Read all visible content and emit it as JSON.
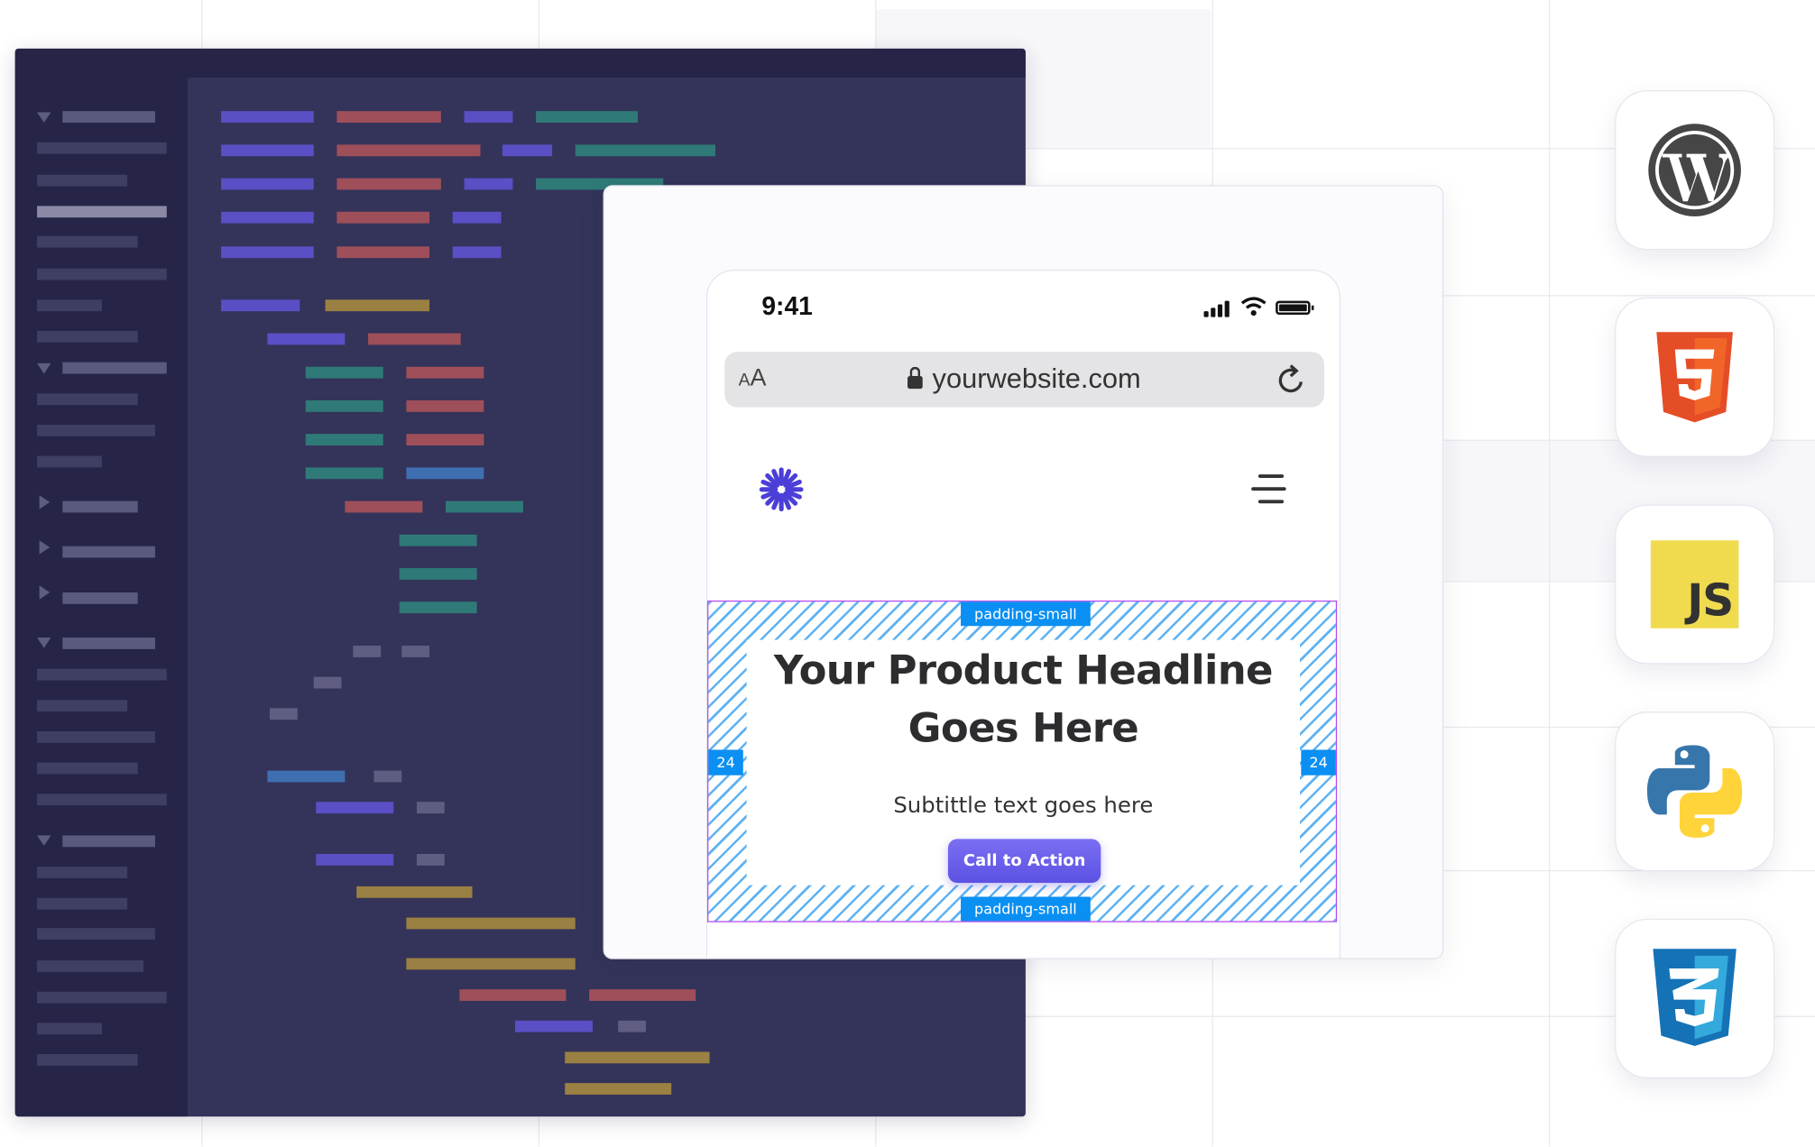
{
  "phone": {
    "status_time": "9:41",
    "url": "yourwebsite.com",
    "aa_label_small": "A",
    "aa_label_large": "A"
  },
  "hero": {
    "headline_line1": "Your Product Headline",
    "headline_line2": "Goes Here",
    "subtitle": "Subtittle text goes here",
    "cta_label": "Call to Action",
    "padding_top_label": "padding-small",
    "padding_bottom_label": "padding-small",
    "padding_left_value": "24",
    "padding_right_value": "24"
  },
  "tech_icons": {
    "js_label": "JS",
    "items": [
      "wordpress-icon",
      "html5-icon",
      "javascript-icon",
      "python-icon",
      "css3-icon"
    ]
  },
  "colors": {
    "editor_bg": "#34335a",
    "accent_purple": "#5c52e3",
    "padding_blue": "#0a8ff2"
  }
}
